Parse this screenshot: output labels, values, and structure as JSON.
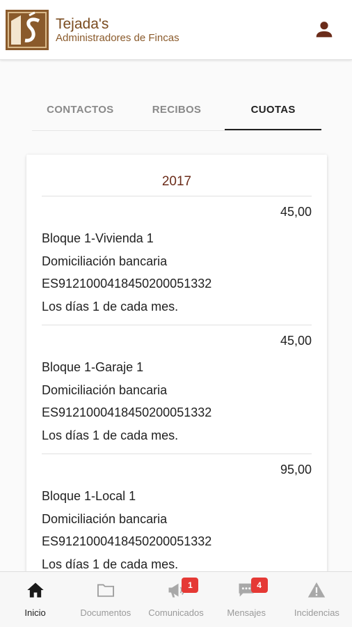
{
  "header": {
    "brand_title": "Tejada's",
    "brand_subtitle": "Administradores de Fincas",
    "logo_glyph": "TS",
    "colors": {
      "brand": "#8a5a2b"
    }
  },
  "tabs": [
    {
      "label": "CONTACTOS",
      "active": false
    },
    {
      "label": "RECIBOS",
      "active": false
    },
    {
      "label": "CUOTAS",
      "active": true
    }
  ],
  "cuotas": {
    "year": "2017",
    "items": [
      {
        "amount": "45,00",
        "unit": "Bloque 1-Vivienda 1",
        "method": "Domiciliación bancaria",
        "iban": "ES9121000418450200051332",
        "schedule": "Los días 1 de cada mes."
      },
      {
        "amount": "45,00",
        "unit": "Bloque 1-Garaje 1",
        "method": "Domiciliación bancaria",
        "iban": "ES9121000418450200051332",
        "schedule": "Los días 1 de cada mes."
      },
      {
        "amount": "95,00",
        "unit": "Bloque 1-Local 1",
        "method": "Domiciliación bancaria",
        "iban": "ES9121000418450200051332",
        "schedule": "Los días 1 de cada mes."
      }
    ]
  },
  "bottom_nav": [
    {
      "label": "Inicio",
      "icon": "home-icon",
      "active": true
    },
    {
      "label": "Documentos",
      "icon": "folder-icon",
      "active": false
    },
    {
      "label": "Comunicados",
      "icon": "megaphone-icon",
      "active": false,
      "badge": "1"
    },
    {
      "label": "Mensajes",
      "icon": "chat-icon",
      "active": false,
      "badge": "4"
    },
    {
      "label": "Incidencias",
      "icon": "warning-icon",
      "active": false
    }
  ]
}
